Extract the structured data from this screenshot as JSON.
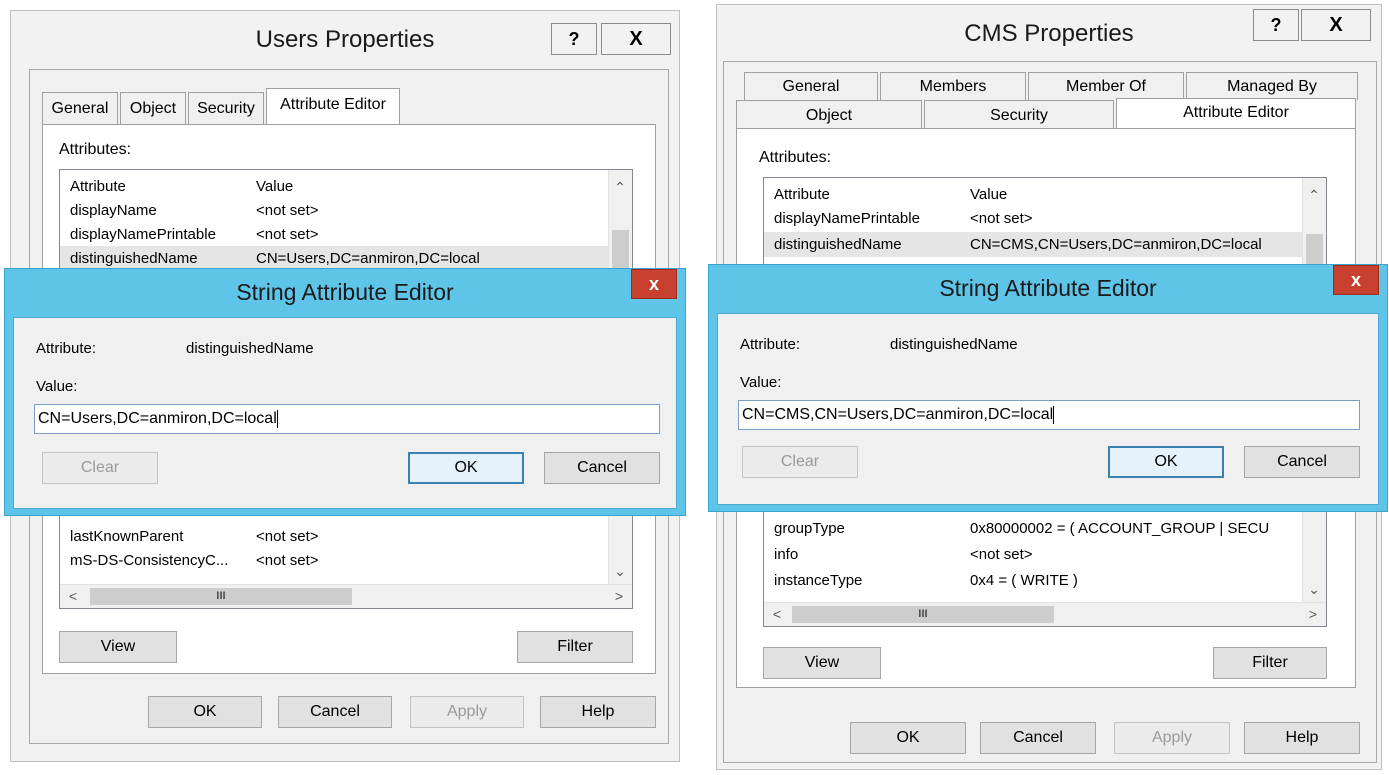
{
  "left": {
    "title": "Users Properties",
    "help_btn": "?",
    "close_btn": "X",
    "tabs": [
      "General",
      "Object",
      "Security",
      "Attribute Editor"
    ],
    "attributes_label": "Attributes:",
    "columns": [
      "Attribute",
      "Value"
    ],
    "rows_top": [
      {
        "attr": "displayName",
        "value": "<not set>"
      },
      {
        "attr": "displayNamePrintable",
        "value": "<not set>"
      },
      {
        "attr": "distinguishedName",
        "value": "CN=Users,DC=anmiron,DC=local"
      }
    ],
    "rows_bottom": [
      {
        "attr": "lastKnownParent",
        "value": "<not set>"
      },
      {
        "attr": "mS-DS-ConsistencyC...",
        "value": "<not set>"
      }
    ],
    "scroll_grip": "III",
    "view_btn": "View",
    "filter_btn": "Filter",
    "ok_btn": "OK",
    "cancel_btn": "Cancel",
    "apply_btn": "Apply",
    "help_button": "Help",
    "editor": {
      "title": "String Attribute Editor",
      "close": "x",
      "attribute_label": "Attribute:",
      "attribute_value": "distinguishedName",
      "value_label": "Value:",
      "value": "CN=Users,DC=anmiron,DC=local",
      "clear_btn": "Clear",
      "ok_btn": "OK",
      "cancel_btn": "Cancel"
    }
  },
  "right": {
    "title": "CMS Properties",
    "help_btn": "?",
    "close_btn": "X",
    "tabs_row1": [
      "General",
      "Members",
      "Member Of",
      "Managed By"
    ],
    "tabs_row2": [
      "Object",
      "Security",
      "Attribute Editor"
    ],
    "attributes_label": "Attributes:",
    "columns": [
      "Attribute",
      "Value"
    ],
    "rows_top": [
      {
        "attr": "displayNamePrintable",
        "value": "<not set>"
      },
      {
        "attr": "distinguishedName",
        "value": "CN=CMS,CN=Users,DC=anmiron,DC=local"
      }
    ],
    "rows_bottom": [
      {
        "attr": "groupType",
        "value": "0x80000002 = ( ACCOUNT_GROUP | SECU"
      },
      {
        "attr": "info",
        "value": "<not set>"
      },
      {
        "attr": "instanceType",
        "value": "0x4 = ( WRITE )"
      }
    ],
    "scroll_grip": "III",
    "view_btn": "View",
    "filter_btn": "Filter",
    "ok_btn": "OK",
    "cancel_btn": "Cancel",
    "apply_btn": "Apply",
    "help_button": "Help",
    "editor": {
      "title": "String Attribute Editor",
      "close": "x",
      "attribute_label": "Attribute:",
      "attribute_value": "distinguishedName",
      "value_label": "Value:",
      "value": "CN=CMS,CN=Users,DC=anmiron,DC=local",
      "clear_btn": "Clear",
      "ok_btn": "OK",
      "cancel_btn": "Cancel"
    }
  },
  "colors": {
    "dialog_frame": "#5ec4e8",
    "close_red": "#c8402f",
    "window_bg": "#f2f2f2"
  }
}
